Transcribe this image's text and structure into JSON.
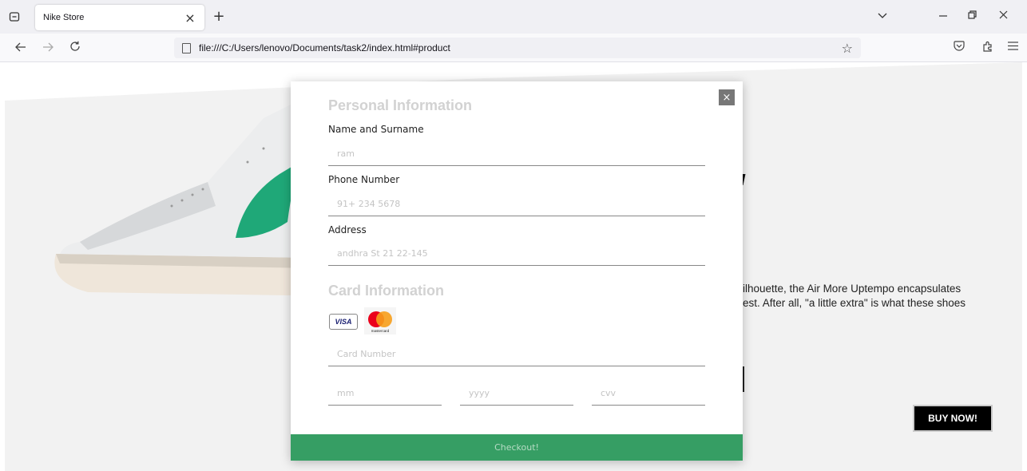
{
  "browser": {
    "tab_title": "Nike Store",
    "tab_close": "×",
    "new_tab": "+",
    "url": "file:///C:/Users/lenovo/Documents/task2/index.html#product"
  },
  "page": {
    "description_lines": [
      "ilhouette, the Air More Uptempo encapsulates",
      "est. After all, \"a little extra\" is what these shoes"
    ],
    "buy_now": "BUY NOW!",
    "accent_color": "#369e64"
  },
  "modal": {
    "close": "×",
    "personal_title": "Personal Information",
    "fields": [
      {
        "label": "Name and Surname",
        "placeholder": "ram"
      },
      {
        "label": "Phone Number",
        "placeholder": "91+ 234 5678"
      },
      {
        "label": "Address",
        "placeholder": "andhra St 21 22-145"
      }
    ],
    "card_title": "Card Information",
    "visa_text": "VISA",
    "mastercard_text": "mastercard",
    "card_number_placeholder": "Card Number",
    "mm_placeholder": "mm",
    "yyyy_placeholder": "yyyy",
    "cvv_placeholder": "cvv",
    "checkout": "Checkout!"
  }
}
